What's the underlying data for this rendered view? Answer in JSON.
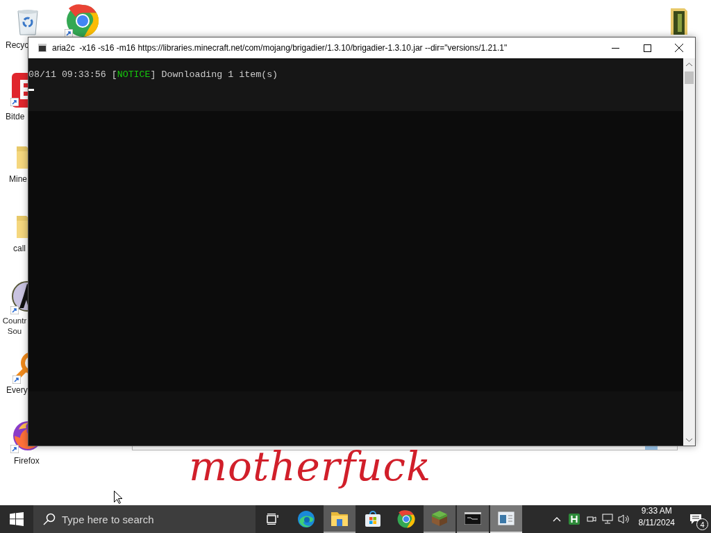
{
  "desktop": {
    "icons": [
      {
        "kind": "recycle-bin",
        "label": "Recyc"
      },
      {
        "kind": "chrome"
      },
      {
        "kind": "red-app",
        "label": "Bitde"
      },
      {
        "kind": "folder",
        "label": "Mine"
      },
      {
        "kind": "folder",
        "label": "call"
      },
      {
        "kind": "game",
        "label": "Countr Sou"
      },
      {
        "kind": "search-app",
        "label": "Every"
      },
      {
        "kind": "firefox",
        "label": "Firefox"
      },
      {
        "kind": "book"
      }
    ]
  },
  "console": {
    "title": "aria2c  -x16 -s16 -m16 https://libraries.minecraft.net/com/mojang/brigadier/1.3.10/brigadier-1.3.10.jar --dir=\"versions/1.21.1\"",
    "lines": [
      {
        "prefix": "08/11 09:33:56 [",
        "level": "NOTICE",
        "suffix": "] Downloading 1 item(s)"
      }
    ]
  },
  "overlay_text": "motherfuck",
  "taskbar": {
    "search": {
      "placeholder": "Type here to search"
    },
    "apps": [
      {
        "kind": "task-view",
        "open": false,
        "selected": false
      },
      {
        "kind": "edge",
        "open": false,
        "selected": false
      },
      {
        "kind": "explorer",
        "open": true,
        "selected": false
      },
      {
        "kind": "store",
        "open": false,
        "selected": false
      },
      {
        "kind": "chrome",
        "open": false,
        "selected": false
      },
      {
        "kind": "grass-block",
        "open": true,
        "selected": false
      },
      {
        "kind": "terminal",
        "open": true,
        "selected": false
      },
      {
        "kind": "window",
        "open": true,
        "selected": true
      }
    ],
    "tray": {
      "time": "9:33 AM",
      "date": "8/11/2024",
      "notifications": "4"
    }
  }
}
